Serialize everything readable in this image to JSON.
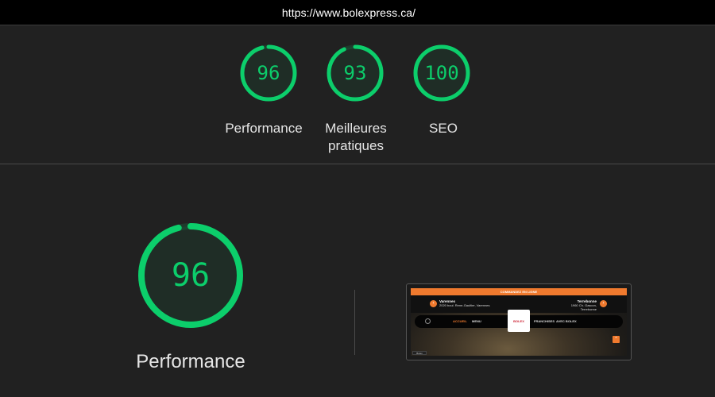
{
  "url": "https://www.bolexpress.ca/",
  "colors": {
    "pass": "#0cce6b",
    "background": "#212121",
    "accent_orange": "#f07a2e"
  },
  "summary_scores": [
    {
      "label": "Performance",
      "score": 96
    },
    {
      "label": "Meilleures pratiques",
      "score": 93
    },
    {
      "label": "SEO",
      "score": 100
    }
  ],
  "detail": {
    "label": "Performance",
    "score": 96
  },
  "screenshot_thumbnail": {
    "banner": "COMMANDEZ EN LIGNE",
    "left_info_title": "Varennes",
    "left_info_sub": "2020 boul. Rene-Gaultier, Varennes",
    "right_info_title": "Terrebonne",
    "right_info_sub": "1960 Ch. Gascon, Terrebonne",
    "nav_items": [
      "ACCUEIL",
      "MENU",
      "FRANCHISES",
      "AVEC BOLEX"
    ],
    "logo_text": "BOLEX",
    "corner_badge": "Bolex Express"
  }
}
